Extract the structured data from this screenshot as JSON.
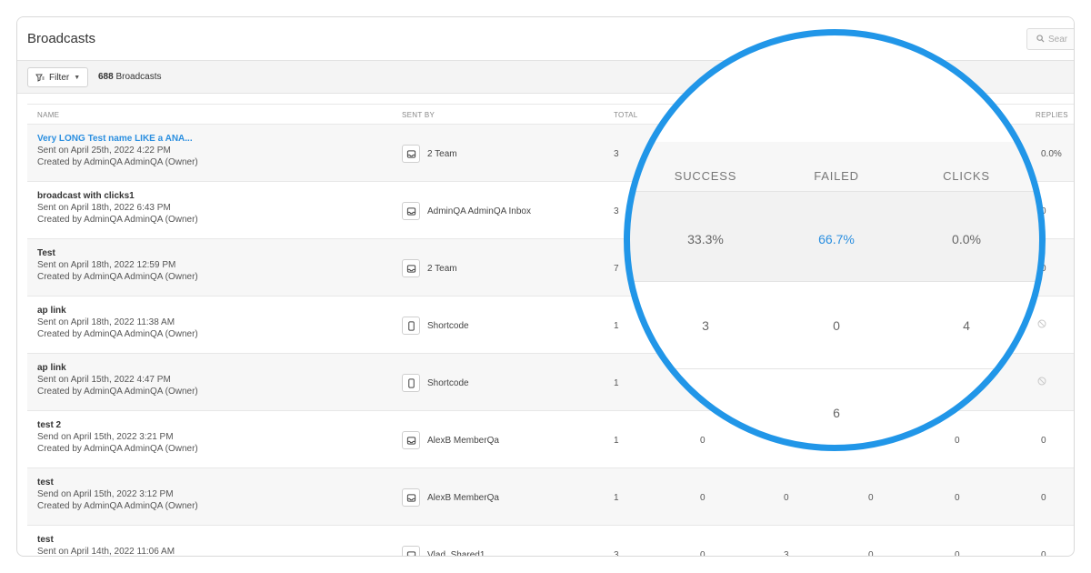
{
  "header": {
    "title": "Broadcasts",
    "search_placeholder": "Sear"
  },
  "toolbar": {
    "filter_label": "Filter",
    "count_number": "688",
    "count_label": "Broadcasts"
  },
  "columns": {
    "name": "NAME",
    "sent_by": "SENT BY",
    "total": "TOTAL",
    "replies": "REPLIES"
  },
  "rows": [
    {
      "name": "Very LONG Test name LIKE a ANA...",
      "line1": "Sent on April 25th, 2022 4:22 PM",
      "line2": "Created by AdminQA AdminQA (Owner)",
      "sender": "2 Team",
      "sender_icon": "inbox-icon",
      "total": "3",
      "success": "",
      "failed": "",
      "failed2": "",
      "clicks": "",
      "replies": "0.0%"
    },
    {
      "name": "broadcast with clicks1",
      "line1": "Sent on April 18th, 2022 6:43 PM",
      "line2": "Created by AdminQA AdminQA (Owner)",
      "sender": "AdminQA AdminQA Inbox",
      "sender_icon": "inbox-icon",
      "total": "3",
      "success": "",
      "failed": "",
      "failed2": "",
      "clicks": "",
      "replies": "0"
    },
    {
      "name": "Test",
      "line1": "Sent on April 18th, 2022 12:59 PM",
      "line2": "Created by AdminQA AdminQA (Owner)",
      "sender": "2 Team",
      "sender_icon": "inbox-icon",
      "total": "7",
      "success": "",
      "failed": "",
      "failed2": "",
      "clicks": "",
      "replies": "0"
    },
    {
      "name": "ap link",
      "line1": "Sent on April 18th, 2022 11:38 AM",
      "line2": "Created by AdminQA AdminQA (Owner)",
      "sender": "Shortcode",
      "sender_icon": "phone-icon",
      "total": "1",
      "success": "",
      "failed": "",
      "failed2": "",
      "clicks": "",
      "replies": ""
    },
    {
      "name": "ap link",
      "line1": "Sent on April 15th, 2022 4:47 PM",
      "line2": "Created by AdminQA AdminQA (Owner)",
      "sender": "Shortcode",
      "sender_icon": "phone-icon",
      "total": "1",
      "success": "",
      "failed": "",
      "failed2": "",
      "clicks": "",
      "replies": ""
    },
    {
      "name": "test 2",
      "line1": "Send on April 15th, 2022 3:21 PM",
      "line2": "Created by AdminQA AdminQA (Owner)",
      "sender": "AlexB MemberQa",
      "sender_icon": "inbox-icon",
      "total": "1",
      "success": "0",
      "failed": "",
      "failed2": "",
      "clicks": "0",
      "replies": "0"
    },
    {
      "name": "test",
      "line1": "Send on April 15th, 2022 3:12 PM",
      "line2": "Created by AdminQA AdminQA (Owner)",
      "sender": "AlexB MemberQa",
      "sender_icon": "inbox-icon",
      "total": "1",
      "success": "0",
      "failed": "0",
      "failed2": "0",
      "clicks": "0",
      "replies": "0"
    },
    {
      "name": "test",
      "line1": "Sent on April 14th, 2022 11:06 AM",
      "line2": "",
      "sender": "Vlad_Shared1",
      "sender_icon": "inbox-icon",
      "total": "3",
      "success": "0",
      "failed": "3",
      "failed2": "0",
      "clicks": "0",
      "replies": "0"
    }
  ],
  "magnifier": {
    "headers": {
      "success": "SUCCESS",
      "failed": "FAILED",
      "clicks": "CLICKS"
    },
    "rate_row": {
      "success": "33.3%",
      "failed": "66.7%",
      "clicks": "0.0%"
    },
    "count_row": {
      "success": "3",
      "failed": "0",
      "clicks": "4"
    },
    "bottom_value": "6",
    "ring_color": "#2196e8",
    "accent_color": "#2b8fe0"
  }
}
